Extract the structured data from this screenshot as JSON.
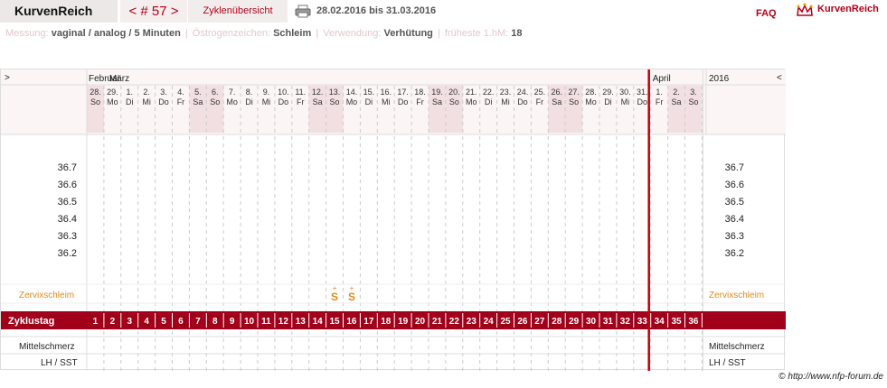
{
  "header": {
    "app_name": "KurvenReich",
    "cycle_nav": "< # 57 >",
    "cycle_overview": "Zyklenübersicht",
    "print_icon": "printer-icon",
    "date_range": "28.02.2016 bis 31.03.2016",
    "faq": "FAQ",
    "brand_icon": "crown-logo-icon",
    "brand_text": "KurvenReich"
  },
  "info": [
    {
      "label": "Messung:",
      "value": "vaginal / analog / 5 Minuten"
    },
    {
      "label": "Östrogenzeichen:",
      "value": "Schleim"
    },
    {
      "label": "Verwendung:",
      "value": "Verhütung"
    },
    {
      "label": "früheste 1.hM:",
      "value": "18"
    }
  ],
  "chart": {
    "left_nav": ">",
    "right_nav": "<",
    "year": "2016",
    "months": [
      {
        "name": "Februar",
        "start": 0
      },
      {
        "name": "März",
        "start": 1
      },
      {
        "name": "April",
        "start": 33
      }
    ],
    "days": [
      {
        "d": "28.",
        "w": "So",
        "we": true
      },
      {
        "d": "29.",
        "w": "Mo",
        "we": false
      },
      {
        "d": "1.",
        "w": "Di",
        "we": false
      },
      {
        "d": "2.",
        "w": "Mi",
        "we": false
      },
      {
        "d": "3.",
        "w": "Do",
        "we": false
      },
      {
        "d": "4.",
        "w": "Fr",
        "we": false
      },
      {
        "d": "5.",
        "w": "Sa",
        "we": true
      },
      {
        "d": "6.",
        "w": "So",
        "we": true
      },
      {
        "d": "7.",
        "w": "Mo",
        "we": false
      },
      {
        "d": "8.",
        "w": "Di",
        "we": false
      },
      {
        "d": "9.",
        "w": "Mi",
        "we": false
      },
      {
        "d": "10.",
        "w": "Do",
        "we": false
      },
      {
        "d": "11.",
        "w": "Fr",
        "we": false
      },
      {
        "d": "12.",
        "w": "Sa",
        "we": true
      },
      {
        "d": "13.",
        "w": "So",
        "we": true
      },
      {
        "d": "14.",
        "w": "Mo",
        "we": false
      },
      {
        "d": "15.",
        "w": "Di",
        "we": false
      },
      {
        "d": "16.",
        "w": "Mi",
        "we": false
      },
      {
        "d": "17.",
        "w": "Do",
        "we": false
      },
      {
        "d": "18.",
        "w": "Fr",
        "we": false
      },
      {
        "d": "19.",
        "w": "Sa",
        "we": true
      },
      {
        "d": "20.",
        "w": "So",
        "we": true
      },
      {
        "d": "21.",
        "w": "Mo",
        "we": false
      },
      {
        "d": "22.",
        "w": "Di",
        "we": false
      },
      {
        "d": "23.",
        "w": "Mi",
        "we": false
      },
      {
        "d": "24.",
        "w": "Do",
        "we": false
      },
      {
        "d": "25.",
        "w": "Fr",
        "we": false
      },
      {
        "d": "26.",
        "w": "Sa",
        "we": true
      },
      {
        "d": "27.",
        "w": "So",
        "we": true
      },
      {
        "d": "28.",
        "w": "Mo",
        "we": false
      },
      {
        "d": "29.",
        "w": "Di",
        "we": false
      },
      {
        "d": "30.",
        "w": "Mi",
        "we": false
      },
      {
        "d": "31.",
        "w": "Do",
        "we": false
      },
      {
        "d": "1.",
        "w": "Fr",
        "we": false
      },
      {
        "d": "2.",
        "w": "Sa",
        "we": true
      },
      {
        "d": "3.",
        "w": "So",
        "we": true
      }
    ],
    "temps": [
      "36.7",
      "36.6",
      "36.5",
      "36.4",
      "36.3",
      "36.2"
    ],
    "row_zervix": "Zervixschleim",
    "mucus": [
      {
        "index": 14,
        "symbol": "S+"
      },
      {
        "index": 15,
        "symbol": "S+"
      }
    ],
    "row_zyklustag": "Zyklustag",
    "cycle_days": [
      "1",
      "2",
      "3",
      "4",
      "5",
      "6",
      "7",
      "8",
      "9",
      "10",
      "11",
      "12",
      "13",
      "14",
      "15",
      "16",
      "17",
      "18",
      "19",
      "20",
      "21",
      "22",
      "23",
      "24",
      "25",
      "26",
      "27",
      "28",
      "29",
      "30",
      "31",
      "32",
      "33",
      "34",
      "35",
      "36"
    ],
    "row_mittelschmerz": "Mittelschmerz",
    "row_lh": "LH / SST",
    "cycle_end_index": 33,
    "accent": "#a0001a"
  },
  "credit": {
    "copy": "©",
    "text": "http://www.nfp-forum.de"
  }
}
